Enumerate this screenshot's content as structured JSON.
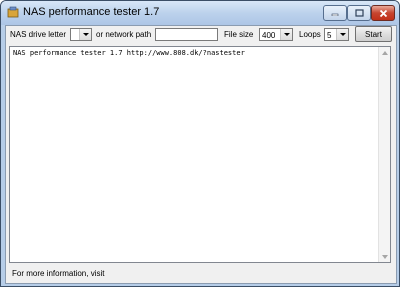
{
  "window": {
    "title": "NAS performance tester 1.7"
  },
  "toolbar": {
    "drive_label": "NAS drive letter",
    "drive_value": "",
    "network_label": "or network path",
    "network_value": "",
    "filesize_label": "File size",
    "filesize_value": "400",
    "loops_label": "Loops",
    "loops_value": "5",
    "start_label": "Start"
  },
  "output": {
    "text": "NAS performance tester 1.7 http://www.808.dk/?nastester"
  },
  "status": {
    "text": "For more information, visit"
  }
}
